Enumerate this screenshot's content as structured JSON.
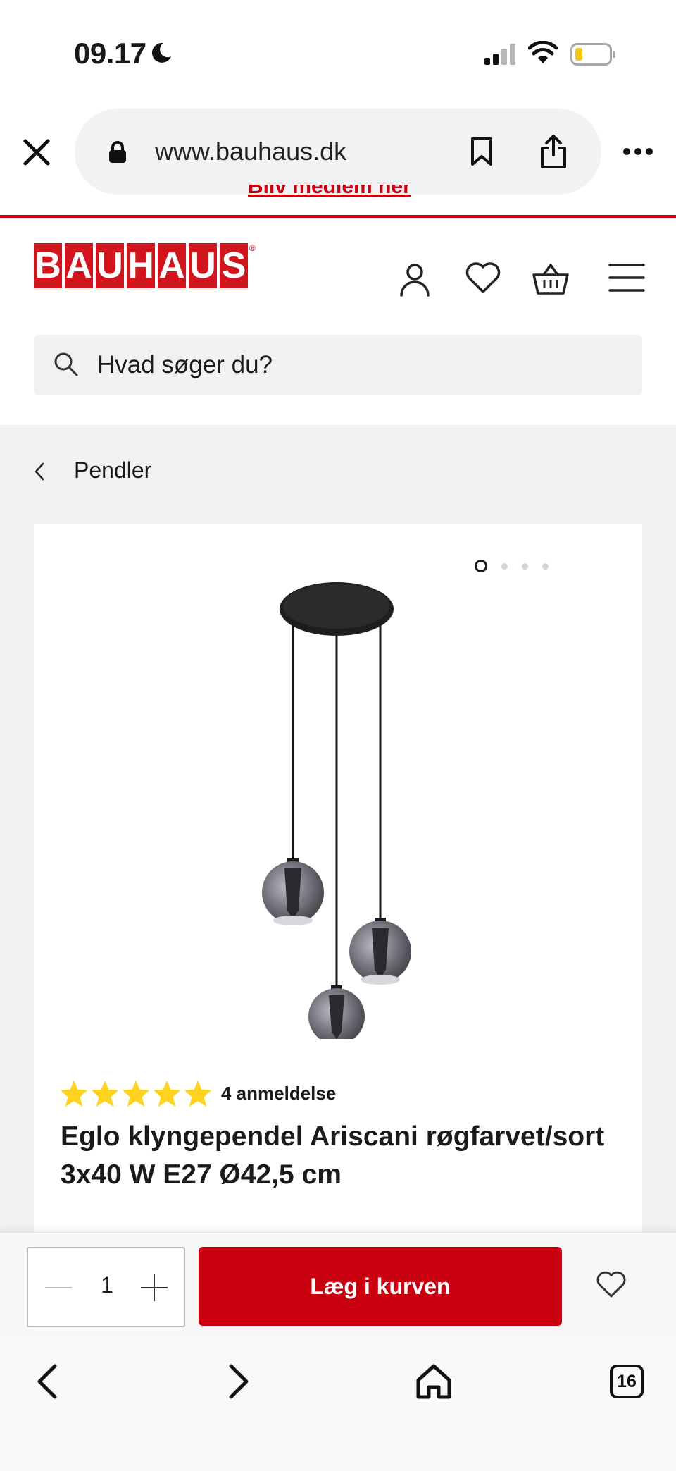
{
  "status_bar": {
    "time": "09.17",
    "icons": [
      "moon-icon",
      "signal-icon",
      "wifi-icon",
      "battery-icon"
    ]
  },
  "browser": {
    "url": "www.bauhaus.dk",
    "icons": [
      "close-icon",
      "lock-icon",
      "bookmark-icon",
      "share-icon",
      "more-icon"
    ]
  },
  "header": {
    "logo_text": "BAUHAUS",
    "icons": [
      "user-icon",
      "heart-icon",
      "basket-icon",
      "menu-icon"
    ],
    "brand_color": "#d2151d"
  },
  "search": {
    "placeholder": "Hvad søger du?"
  },
  "breadcrumb": {
    "label": "Pendler"
  },
  "product": {
    "image_count": 4,
    "active_image": 1,
    "rating_stars": 5,
    "review_count_text": "4 anmeldelse",
    "title": "Eglo klyngependel Ariscani røgfarvet/sort 3x40 W E27 Ø42,5 cm"
  },
  "cart": {
    "quantity": "1",
    "add_label": "Læg i kurven",
    "button_color": "#c8000f"
  },
  "toolbar": {
    "tab_count": "16",
    "icons": [
      "back-icon",
      "forward-icon",
      "home-icon",
      "tabs-icon"
    ]
  }
}
